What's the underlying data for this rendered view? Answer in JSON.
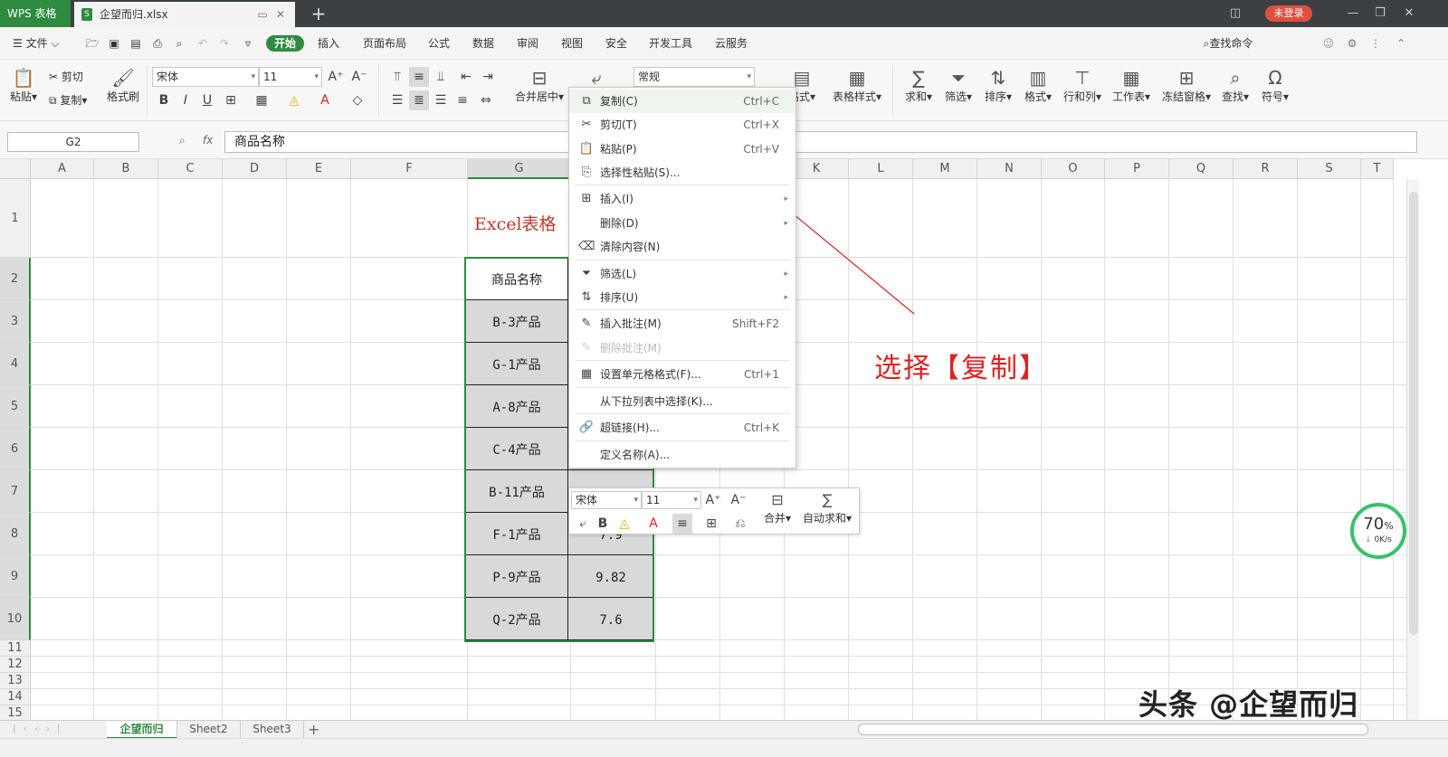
{
  "titlebar": {
    "app_tab": "WPS 表格",
    "doc_tab": "企望而归.xlsx",
    "login": "未登录"
  },
  "menu": {
    "items": [
      "文件",
      "开始",
      "插入",
      "页面布局",
      "公式",
      "数据",
      "审阅",
      "视图",
      "安全",
      "开发工具",
      "云服务"
    ],
    "search": "查找命令"
  },
  "ribbon": {
    "paste": "粘贴",
    "cut": "剪切",
    "copy": "复制",
    "format_painter": "格式刷",
    "font_name": "宋体",
    "font_size": "11",
    "merge_center": "合并居中",
    "number_format": "常规",
    "cond_format": "格式",
    "table_style": "表格样式",
    "sum": "求和",
    "filter": "筛选",
    "sort": "排序",
    "format": "格式",
    "row_col": "行和列",
    "worksheet": "工作表",
    "freeze": "冻结窗格",
    "find": "查找",
    "symbol": "符号"
  },
  "formula": {
    "name_box": "G2",
    "fx": "fx",
    "content": "商品名称"
  },
  "columns": [
    "A",
    "B",
    "C",
    "D",
    "E",
    "F",
    "G",
    "H",
    "I",
    "J",
    "K",
    "L",
    "M",
    "N",
    "O",
    "P",
    "Q",
    "R",
    "S",
    "T"
  ],
  "rows": [
    "1",
    "2",
    "3",
    "4",
    "5",
    "6",
    "7",
    "8",
    "9",
    "10",
    "11",
    "12",
    "13",
    "14",
    "15"
  ],
  "sheet": {
    "title": "Excel表格",
    "header_g": "商品名称",
    "products": [
      "B-3产品",
      "G-1产品",
      "A-8产品",
      "C-4产品",
      "B-11产品",
      "F-1产品",
      "P-9产品",
      "Q-2产品"
    ],
    "h_values": [
      "7.9",
      "9.82",
      "7.6"
    ]
  },
  "context_menu": {
    "items": [
      {
        "label": "复制(C)",
        "shortcut": "Ctrl+C",
        "icon": "copy-icon"
      },
      {
        "label": "剪切(T)",
        "shortcut": "Ctrl+X",
        "icon": "scissors-icon"
      },
      {
        "label": "粘贴(P)",
        "shortcut": "Ctrl+V",
        "icon": "paste-icon"
      },
      {
        "label": "选择性粘贴(S)...",
        "shortcut": "",
        "icon": "paste-special-icon"
      },
      {
        "label": "插入(I)",
        "shortcut": "",
        "icon": "insert-icon"
      },
      {
        "label": "删除(D)",
        "shortcut": "",
        "icon": ""
      },
      {
        "label": "清除内容(N)",
        "shortcut": "",
        "icon": "eraser-icon"
      },
      {
        "label": "筛选(L)",
        "shortcut": "",
        "icon": "filter-icon"
      },
      {
        "label": "排序(U)",
        "shortcut": "",
        "icon": "sort-icon"
      },
      {
        "label": "插入批注(M)",
        "shortcut": "Shift+F2",
        "icon": "comment-icon"
      },
      {
        "label": "删除批注(M)",
        "shortcut": "",
        "icon": "comment-delete-icon"
      },
      {
        "label": "设置单元格格式(F)...",
        "shortcut": "Ctrl+1",
        "icon": "format-cells-icon"
      },
      {
        "label": "从下拉列表中选择(K)...",
        "shortcut": "",
        "icon": ""
      },
      {
        "label": "超链接(H)...",
        "shortcut": "Ctrl+K",
        "icon": "link-icon"
      },
      {
        "label": "定义名称(A)...",
        "shortcut": "",
        "icon": ""
      }
    ]
  },
  "mini_toolbar": {
    "font_name": "宋体",
    "font_size": "11",
    "merge": "合并",
    "autosum": "自动求和"
  },
  "annotation": "选择【复制】",
  "progress": {
    "value": "70",
    "unit": "%",
    "speed": "0K/s",
    "fraction": 0.7
  },
  "sheet_tabs": [
    "企望而归",
    "Sheet2",
    "Sheet3"
  ],
  "watermark": "头条 @企望而归",
  "colors": {
    "accent": "#2e8b3f",
    "annotation": "#e02020",
    "title_red": "#c0392b"
  }
}
